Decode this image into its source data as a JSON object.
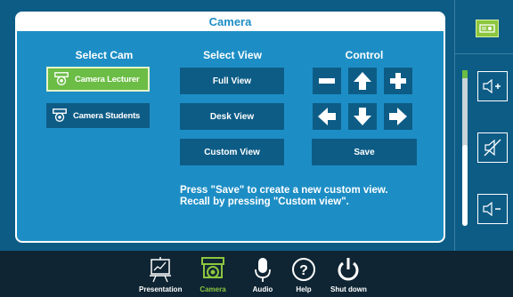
{
  "panel": {
    "title": "Camera"
  },
  "columns": {
    "select_cam": "Select Cam",
    "select_view": "Select View",
    "control": "Control"
  },
  "cameras": [
    {
      "label": "Camera Lecturer",
      "active": true
    },
    {
      "label": "Camera Students",
      "active": false
    }
  ],
  "views": [
    "Full View",
    "Desk View",
    "Custom View"
  ],
  "control": {
    "save_label": "Save"
  },
  "message": {
    "line1": "Press \"Save\" to create a new custom view.",
    "line2": "Recall by pressing \"Custom view\"."
  },
  "volume": {
    "level": 0.53
  },
  "nav": {
    "presentation": "Presentation",
    "camera": "Camera",
    "audio": "Audio",
    "help": "Help",
    "shutdown": "Shut down"
  },
  "colors": {
    "accent": "#8cc63f",
    "panel": "#1d8ec5",
    "button": "#0d5c86",
    "background": "#0f2533"
  },
  "icons": [
    "projector-icon",
    "volume-up-icon",
    "mute-icon",
    "volume-down-icon",
    "camera-icon",
    "minus-icon",
    "plus-icon",
    "arrow-up-icon",
    "arrow-down-icon",
    "arrow-left-icon",
    "arrow-right-icon",
    "presentation-icon",
    "microphone-icon",
    "help-icon",
    "power-icon"
  ]
}
